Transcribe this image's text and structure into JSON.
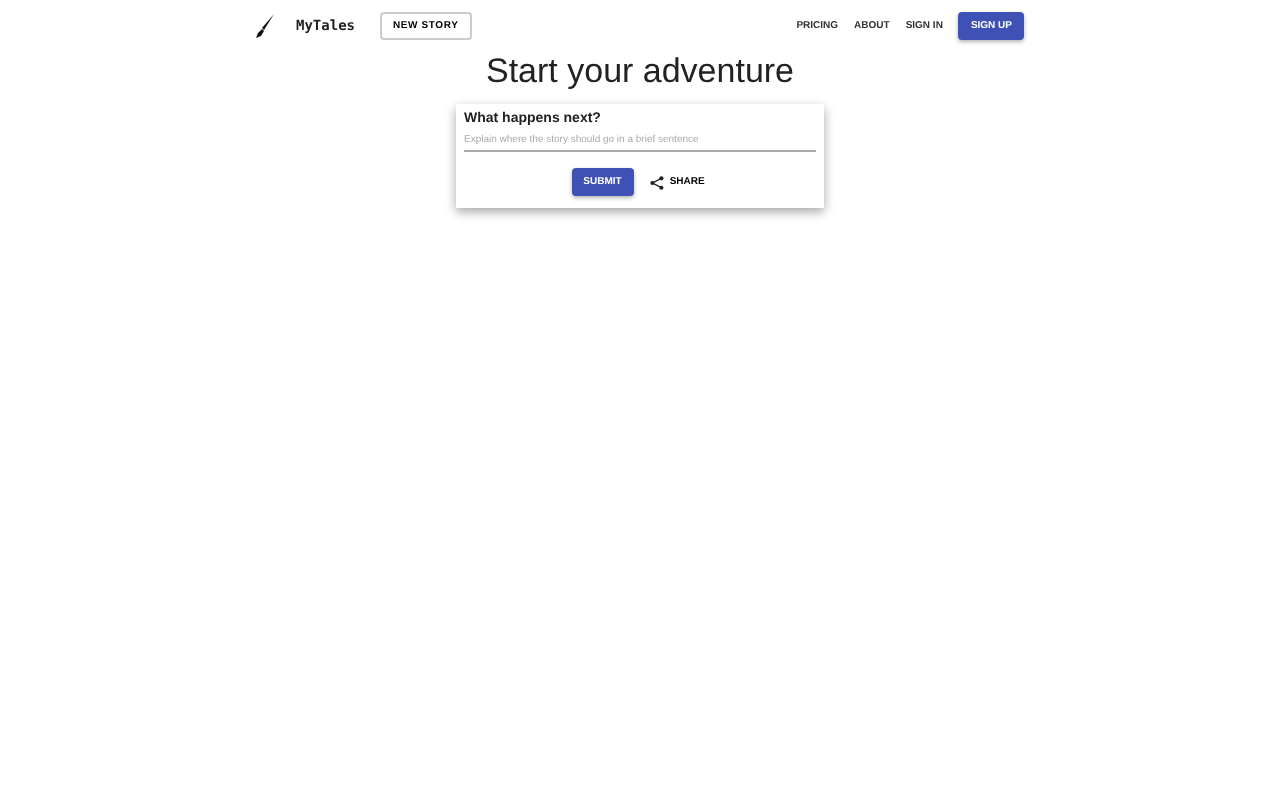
{
  "header": {
    "logo": "MyTales",
    "new_story": "NEW STORY",
    "nav": [
      "PRICING",
      "ABOUT",
      "SIGN IN"
    ],
    "sign_up": "SIGN UP"
  },
  "title": "Start your adventure",
  "card": {
    "question": "What happens next?",
    "placeholder": "Explain where the story should go in a brief sentence",
    "submit": "SUBMIT",
    "share": "SHARE"
  }
}
